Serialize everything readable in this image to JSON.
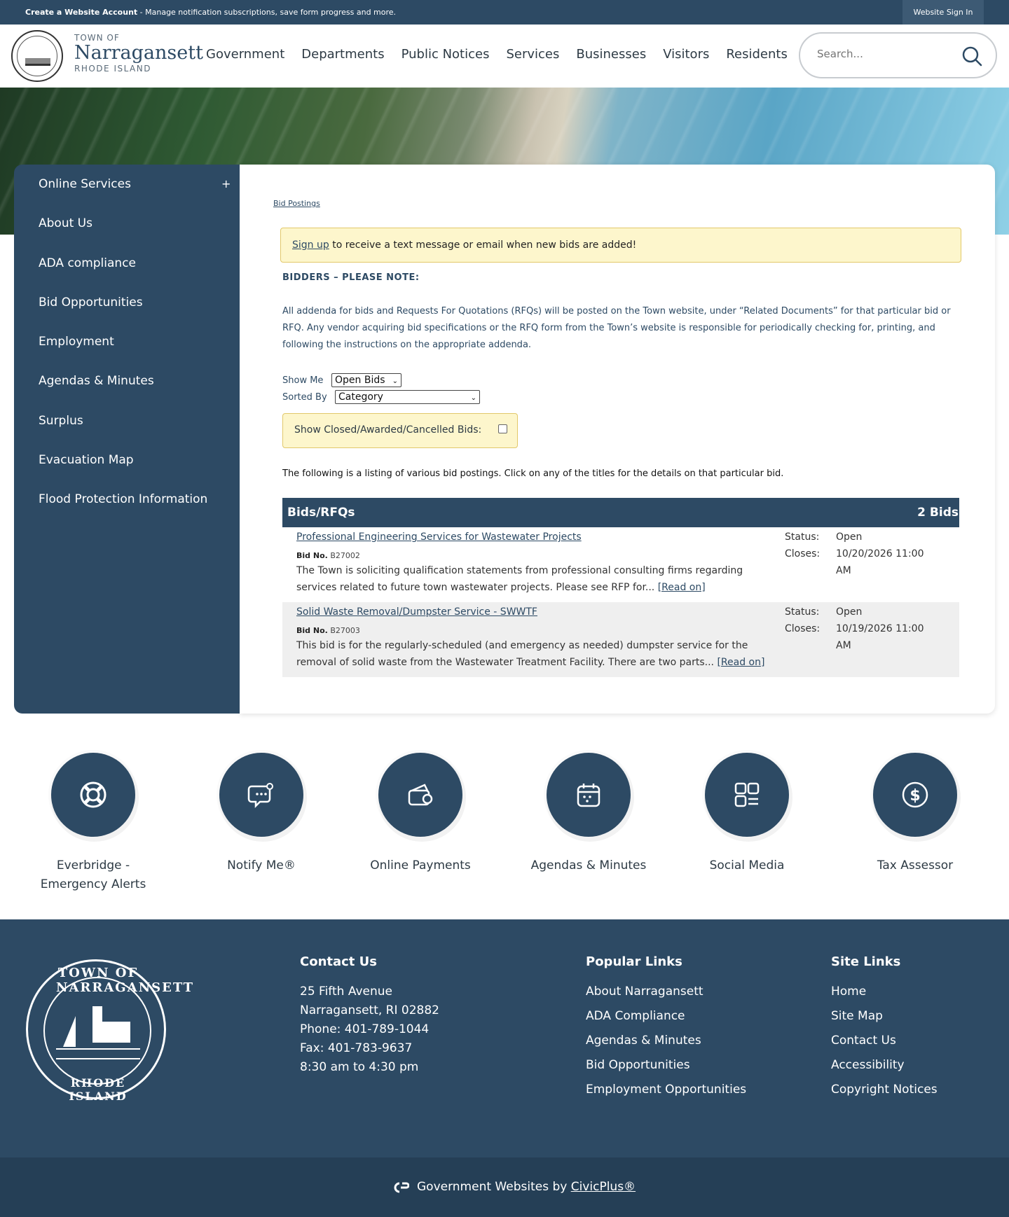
{
  "topbar": {
    "create_account": "Create a Website Account",
    "create_account_desc": " - Manage notification subscriptions, save form progress and more.",
    "sign_in": "Website Sign In"
  },
  "header": {
    "logo_town_of": "TOWN OF",
    "logo_name": "Narragansett",
    "logo_state": "RHODE ISLAND",
    "nav": [
      "Government",
      "Departments",
      "Public Notices",
      "Services",
      "Businesses",
      "Visitors",
      "Residents"
    ],
    "search_placeholder": "Search..."
  },
  "sidebar": {
    "toggle": "+",
    "items": [
      "Online Services",
      "About Us",
      "ADA compliance",
      "Bid Opportunities",
      "Employment",
      "Agendas & Minutes",
      "Surplus",
      "Evacuation Map",
      "Flood Protection Information"
    ]
  },
  "content": {
    "breadcrumb": "Bid Postings",
    "notice_link": "Sign up",
    "notice_text": " to receive a text message or email when new bids are added!",
    "note_title": "BIDDERS – PLEASE NOTE:",
    "note_body": "All addenda for bids and Requests For Quotations (RFQs) will be posted on the Town website, under “Related Documents” for that particular bid or RFQ. Any vendor acquiring bid specifications or the RFQ form from the Town’s website is responsible for periodically checking for, printing, and following the instructions on the appropriate addenda.",
    "show_me_label": "Show Me",
    "show_me_value": "Open Bids",
    "sorted_by_label": "Sorted By",
    "sorted_by_value": "Category",
    "show_closed_label": "Show Closed/Awarded/Cancelled Bids:",
    "listing_intro": "The following is a listing of various bid postings. Click on any of the titles for the details on that particular bid.",
    "table_title": "Bids/RFQs",
    "table_count": "2 Bids",
    "bids": [
      {
        "title": "Professional Engineering Services for Wastewater Projects",
        "bid_no_label": "Bid No.",
        "bid_no": "B27002",
        "desc": "The Town is soliciting qualification statements from professional consulting firms regarding services related to future town wastewater projects. Please see RFP for... ",
        "read_on": "[Read on]",
        "status_label": "Status:",
        "status": "Open",
        "closes_label": "Closes:",
        "closes": "10/20/2026 11:00 AM"
      },
      {
        "title": "Solid Waste Removal/Dumpster Service - SWWTF",
        "bid_no_label": "Bid No.",
        "bid_no": "B27003",
        "desc": "This bid is for the regularly-scheduled (and emergency as needed) dumpster service for the removal of solid waste from the Wastewater Treatment Facility. There are two parts... ",
        "read_on": "[Read on]",
        "status_label": "Status:",
        "status": "Open",
        "closes_label": "Closes:",
        "closes": "10/19/2026 11:00 AM"
      }
    ]
  },
  "quick_links": [
    {
      "label": "Everbridge - Emergency Alerts",
      "icon": "lifebuoy-icon"
    },
    {
      "label": "Notify Me®",
      "icon": "chat-bubble-icon"
    },
    {
      "label": "Online Payments",
      "icon": "wallet-icon"
    },
    {
      "label": "Agendas & Minutes",
      "icon": "calendar-icon"
    },
    {
      "label": "Social Media",
      "icon": "grid-icon"
    },
    {
      "label": "Tax Assessor",
      "icon": "dollar-icon"
    }
  ],
  "footer": {
    "seal_top": "TOWN OF NARRAGANSETT",
    "seal_bottom": "RHODE ISLAND",
    "contact_title": "Contact Us",
    "contact_lines": [
      "25 Fifth Avenue",
      "Narragansett, RI 02882",
      "Phone: 401-789-1044",
      "Fax: 401-783-9637",
      "8:30 am to 4:30 pm"
    ],
    "popular_title": "Popular Links",
    "popular_links": [
      "About Narragansett",
      "ADA Compliance",
      "Agendas & Minutes",
      "Bid Opportunities",
      "Employment Opportunities"
    ],
    "site_title": "Site Links",
    "site_links": [
      "Home",
      "Site Map",
      "Contact Us",
      "Accessibility",
      "Copyright Notices"
    ]
  },
  "bottombar": {
    "text": "Government Websites by ",
    "link": "CivicPlus®"
  },
  "colors": {
    "primary": "#2d4a64",
    "notice_bg": "#fdf6cc",
    "notice_border": "#e2c86a"
  }
}
